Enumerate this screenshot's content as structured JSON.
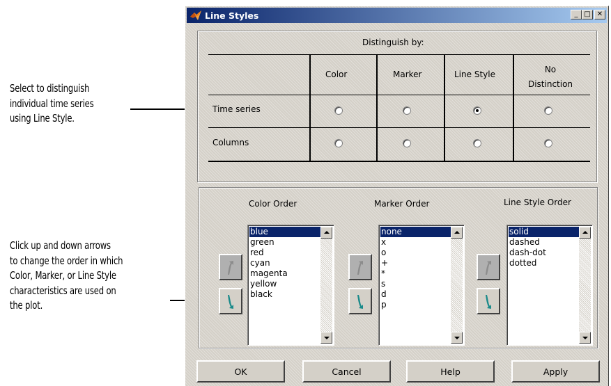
{
  "annotations": {
    "top": [
      "Select to distinguish",
      "individual time series",
      "using Line Style."
    ],
    "bottom": [
      "Click up and down arrows",
      "to change the order in which",
      "Color, Marker, or Line Style",
      "characteristics are used on",
      "the plot."
    ]
  },
  "window": {
    "title": "Line Styles",
    "controls": {
      "minimize": "_",
      "maximize": "□",
      "close": "✕"
    }
  },
  "distinguish": {
    "heading": "Distinguish by:",
    "columns": [
      "Color",
      "Marker",
      "Line Style",
      "No Distinction"
    ],
    "rows": [
      {
        "label": "Time series",
        "selected": "Line Style"
      },
      {
        "label": "Columns",
        "selected": null
      }
    ]
  },
  "orders": [
    {
      "title": "Color Order",
      "items": [
        "blue",
        "green",
        "red",
        "cyan",
        "magenta",
        "yellow",
        "black"
      ],
      "selected": "blue"
    },
    {
      "title": "Marker Order",
      "items": [
        "none",
        "x",
        "o",
        "+",
        "*",
        "s",
        "d",
        "p"
      ],
      "selected": "none"
    },
    {
      "title": "Line Style Order",
      "items": [
        "solid",
        "dashed",
        "dash-dot",
        "dotted"
      ],
      "selected": "solid"
    }
  ],
  "buttons": {
    "ok": "OK",
    "cancel": "Cancel",
    "help": "Help",
    "apply": "Apply"
  },
  "icons": {
    "window": "matlab-logo-icon",
    "move_up": "curved-arrow-up-icon",
    "move_down": "curved-arrow-down-icon",
    "arrow_color": "#1a8a8a"
  }
}
